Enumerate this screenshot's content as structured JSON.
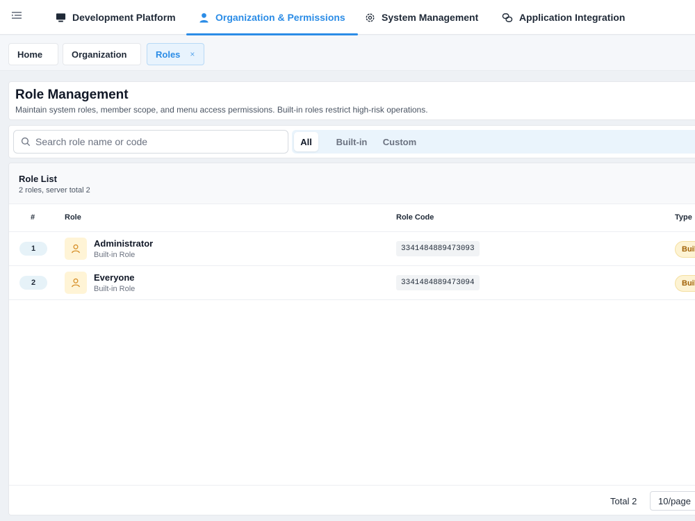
{
  "topnav": {
    "tabs": [
      {
        "label": "Development Platform",
        "icon": "monitor-icon"
      },
      {
        "label": "Organization & Permissions",
        "icon": "user-icon",
        "active": true
      },
      {
        "label": "System Management",
        "icon": "gear-icon"
      },
      {
        "label": "Application Integration",
        "icon": "link-icon"
      }
    ]
  },
  "tabbar": {
    "tabs": [
      {
        "label": "Home"
      },
      {
        "label": "Organization"
      },
      {
        "label": "Roles",
        "active": true,
        "close": "×"
      }
    ]
  },
  "header": {
    "title": "Role Management",
    "description": "Maintain system roles, member scope, and menu access permissions. Built-in roles restrict high-risk operations."
  },
  "filter": {
    "search_placeholder": "Search role name or code",
    "segments": [
      {
        "label": "All",
        "active": true
      },
      {
        "label": "Built-in"
      },
      {
        "label": "Custom"
      }
    ]
  },
  "role_list": {
    "title": "Role List",
    "subtitle": "2 roles, server total 2",
    "columns": {
      "num": "#",
      "role": "Role",
      "code": "Role Code",
      "type": "Type"
    },
    "rows": [
      {
        "num": "1",
        "name": "Administrator",
        "sub": "Built-in Role",
        "code": "3341484889473093",
        "type": "Built-in"
      },
      {
        "num": "2",
        "name": "Everyone",
        "sub": "Built-in Role",
        "code": "3341484889473094",
        "type": "Built-in"
      }
    ]
  },
  "pager": {
    "total": "Total 2",
    "page_size": "10/page"
  },
  "colors": {
    "accent": "#2b8ce6",
    "badge_bg": "#fdf3d3",
    "badge_text": "#a16207",
    "avatar_bg": "#fff4d6"
  }
}
